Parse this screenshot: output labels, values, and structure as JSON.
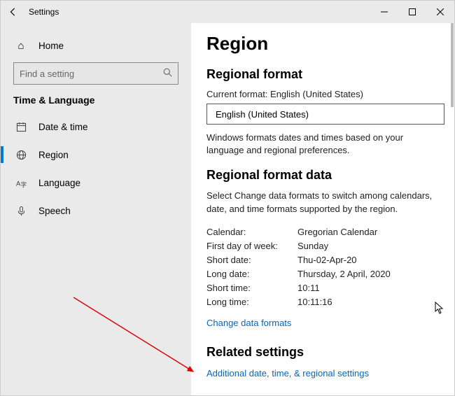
{
  "titlebar": {
    "title": "Settings"
  },
  "sidebar": {
    "home_label": "Home",
    "search_placeholder": "Find a setting",
    "section_header": "Time & Language",
    "items": [
      {
        "label": "Date & time"
      },
      {
        "label": "Region"
      },
      {
        "label": "Language"
      },
      {
        "label": "Speech"
      }
    ]
  },
  "content": {
    "page_title": "Region",
    "section1": {
      "heading": "Regional format",
      "current_label": "Current format: English (United States)",
      "dropdown_value": "English (United States)",
      "description": "Windows formats dates and times based on your language and regional preferences."
    },
    "section2": {
      "heading": "Regional format data",
      "description": "Select Change data formats to switch among calendars, date, and time formats supported by the region.",
      "rows": [
        {
          "k": "Calendar:",
          "v": "Gregorian Calendar"
        },
        {
          "k": "First day of week:",
          "v": "Sunday"
        },
        {
          "k": "Short date:",
          "v": "Thu-02-Apr-20"
        },
        {
          "k": "Long date:",
          "v": "Thursday, 2 April, 2020"
        },
        {
          "k": "Short time:",
          "v": "10:11"
        },
        {
          "k": "Long time:",
          "v": "10:11:16"
        }
      ],
      "link": "Change data formats"
    },
    "section3": {
      "heading": "Related settings",
      "link": "Additional date, time, & regional settings"
    }
  }
}
